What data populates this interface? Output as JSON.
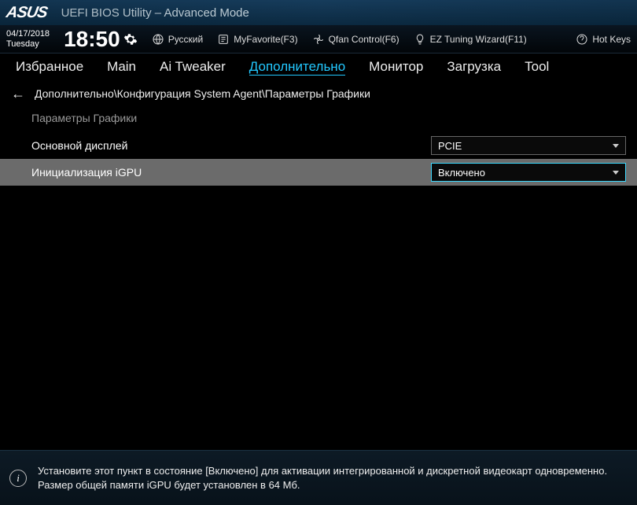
{
  "header": {
    "brand": "ASUS",
    "title": "UEFI BIOS Utility – Advanced Mode"
  },
  "meta": {
    "date": "04/17/2018",
    "day": "Tuesday",
    "time": "18:50",
    "language": "Русский",
    "myfavorite": "MyFavorite(F3)",
    "qfan": "Qfan Control(F6)",
    "ezwizard": "EZ Tuning Wizard(F11)",
    "hotkeys": "Hot Keys"
  },
  "tabs": [
    {
      "label": "Избранное",
      "active": false
    },
    {
      "label": "Main",
      "active": false
    },
    {
      "label": "Ai Tweaker",
      "active": false
    },
    {
      "label": "Дополнительно",
      "active": true
    },
    {
      "label": "Монитор",
      "active": false
    },
    {
      "label": "Загрузка",
      "active": false
    },
    {
      "label": "Tool",
      "active": false
    }
  ],
  "breadcrumb": "Дополнительно\\Конфигурация System Agent\\Параметры Графики",
  "section_heading": "Параметры Графики",
  "settings": [
    {
      "label": "Основной дисплей",
      "value": "PCIE",
      "selected": false
    },
    {
      "label": "Инициализация iGPU",
      "value": "Включено",
      "selected": true
    }
  ],
  "footer": {
    "line1": "Установите этот пункт в состояние [Включено] для активации интегрированной и дискретной видеокарт одновременно.",
    "line2": "Размер общей памяти iGPU будет установлен в 64 Мб."
  }
}
